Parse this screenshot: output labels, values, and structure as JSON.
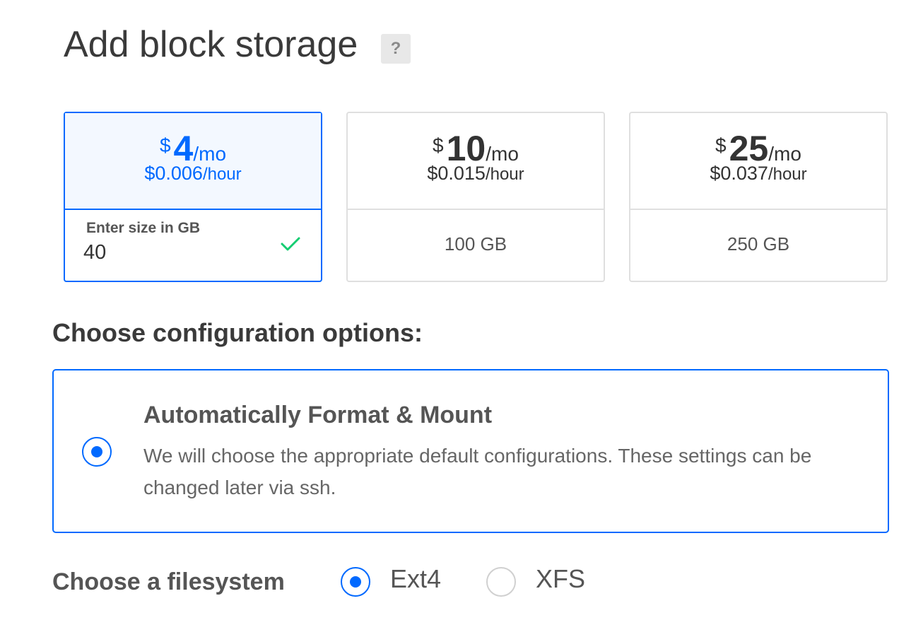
{
  "header": {
    "title": "Add block storage",
    "help_label": "?"
  },
  "plans": [
    {
      "currency": "$",
      "amount": "4",
      "period": "/mo",
      "hourly_amount": "$0.006",
      "hourly_unit": "/hour",
      "selected": true,
      "size_label": "Enter size in GB",
      "size_value": "40"
    },
    {
      "currency": "$",
      "amount": "10",
      "period": "/mo",
      "hourly_amount": "$0.015",
      "hourly_unit": "/hour",
      "size": "100 GB"
    },
    {
      "currency": "$",
      "amount": "25",
      "period": "/mo",
      "hourly_amount": "$0.037",
      "hourly_unit": "/hour",
      "size": "250 GB"
    }
  ],
  "config": {
    "section_title": "Choose configuration options:",
    "option_title": "Automatically Format & Mount",
    "option_description": "We will choose the appropriate default configurations. These settings can be changed later via ssh.",
    "selected": true
  },
  "filesystem": {
    "label": "Choose a filesystem",
    "options": [
      {
        "label": "Ext4",
        "selected": true
      },
      {
        "label": "XFS",
        "selected": false
      }
    ]
  },
  "colors": {
    "accent": "#0069ff",
    "valid_check": "#15cd72",
    "border": "#dfdfdf"
  },
  "icons": {
    "help": "question-mark-icon",
    "valid": "checkmark-icon"
  }
}
